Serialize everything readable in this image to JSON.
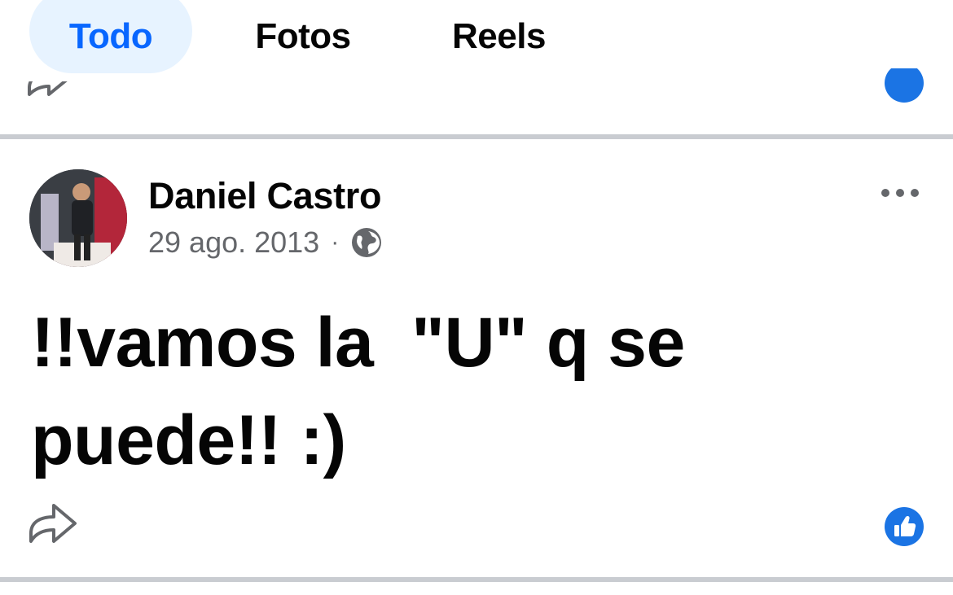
{
  "tabs": [
    {
      "label": "Todo",
      "active": true
    },
    {
      "label": "Fotos",
      "active": false
    },
    {
      "label": "Reels",
      "active": false
    }
  ],
  "post": {
    "author": "Daniel Castro",
    "date": "29 ago. 2013",
    "separator": "·",
    "audience_icon": "globe-icon",
    "text": "!!vamos la  \"U\" q se\npuede!! :)",
    "actions": {
      "share_icon": "share-icon",
      "like_icon": "like-icon",
      "more_icon": "more-options-icon"
    }
  },
  "colors": {
    "accent": "#0866ff",
    "active_tab_bg": "#e7f3ff",
    "like_blue": "#1b74e4",
    "meta_gray": "#65676b",
    "divider": "#c9ccd1"
  }
}
